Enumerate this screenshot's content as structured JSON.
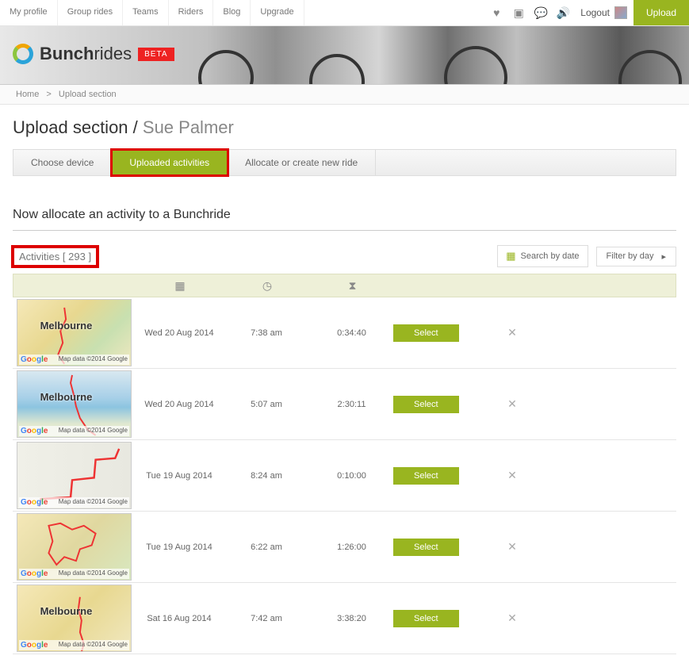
{
  "topnav": {
    "items": [
      "My profile",
      "Group rides",
      "Teams",
      "Riders",
      "Blog",
      "Upgrade"
    ],
    "logout": "Logout",
    "upload": "Upload"
  },
  "logo": {
    "name": "Bunch",
    "suffix": "rides",
    "badge": "BETA"
  },
  "breadcrumb": {
    "home": "Home",
    "sep": ">",
    "current": "Upload section"
  },
  "heading": {
    "main": "Upload section",
    "sep": " / ",
    "sub": "Sue Palmer"
  },
  "tabs": [
    "Choose device",
    "Uploaded activities",
    "Allocate or create new ride"
  ],
  "active_tab": 1,
  "subhead": "Now allocate an activity to a Bunchride",
  "activities_label": "Activities",
  "activities_count": "293",
  "search_date": "Search by date",
  "filter_day": "Filter by day",
  "select_label": "Select",
  "rows": [
    {
      "place": "Melbourne",
      "date": "Wed 20 Aug 2014",
      "time": "7:38 am",
      "dur": "0:34:40",
      "attr": "Map data ©2014 Google",
      "bg": "mapbg1"
    },
    {
      "place": "Melbourne",
      "date": "Wed 20 Aug 2014",
      "time": "5:07 am",
      "dur": "2:30:11",
      "attr": "Map data ©2014 Google",
      "bg": "mapbg2"
    },
    {
      "place": "",
      "date": "Tue 19 Aug 2014",
      "time": "8:24 am",
      "dur": "0:10:00",
      "attr": "Map data ©2014 Google",
      "bg": "mapbg3"
    },
    {
      "place": "",
      "date": "Tue 19 Aug 2014",
      "time": "6:22 am",
      "dur": "1:26:00",
      "attr": "Map data ©2014 Google",
      "bg": "mapbg4"
    },
    {
      "place": "Melbourne",
      "date": "Sat 16 Aug 2014",
      "time": "7:42 am",
      "dur": "3:38:20",
      "attr": "Map data ©2014 Google",
      "bg": "mapbg5"
    }
  ]
}
